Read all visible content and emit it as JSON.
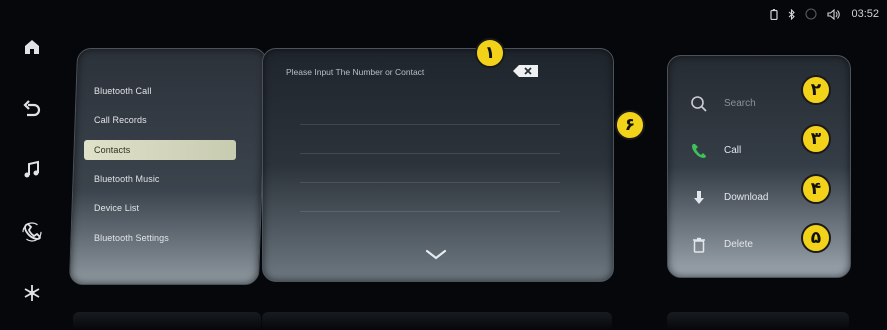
{
  "status_bar": {
    "time": "03:52"
  },
  "rail": {
    "items": [
      {
        "icon": "home-icon"
      },
      {
        "icon": "back-icon"
      },
      {
        "icon": "music-icon"
      },
      {
        "icon": "phone-link-icon"
      },
      {
        "icon": "snowflake-icon"
      }
    ]
  },
  "menu": {
    "items": [
      {
        "label": "Bluetooth Call"
      },
      {
        "label": "Call Records"
      },
      {
        "label": "Contacts",
        "active": true
      },
      {
        "label": "Bluetooth Music"
      },
      {
        "label": "Device List"
      },
      {
        "label": "Bluetooth Settings"
      }
    ]
  },
  "dialer": {
    "placeholder": "Please Input The Number or Contact"
  },
  "actions": {
    "search": "Search",
    "call": "Call",
    "download": "Download",
    "delete": "Delete"
  },
  "callouts": [
    "۱",
    "۲",
    "۳",
    "۴",
    "۵",
    "۶"
  ],
  "colors": {
    "callout": "#f3d21a",
    "call_green": "#3fc15a",
    "active_item": "#dfe2c9"
  }
}
